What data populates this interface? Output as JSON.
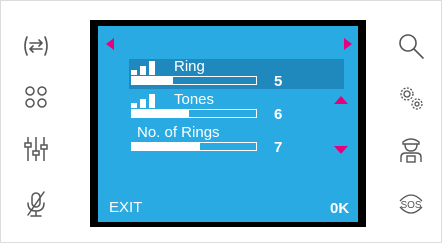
{
  "left_buttons": [
    {
      "icon": "transfer-arrows-icon"
    },
    {
      "icon": "four-circles-icon"
    },
    {
      "icon": "sliders-icon"
    },
    {
      "icon": "mic-muted-icon"
    }
  ],
  "right_buttons": [
    {
      "icon": "search-icon"
    },
    {
      "icon": "settings-gears-icon"
    },
    {
      "icon": "concierge-icon"
    },
    {
      "icon": "sos-icon"
    }
  ],
  "menu": {
    "items": [
      {
        "label": "Ring",
        "value": "5",
        "level": 0.33,
        "selected": true,
        "has_bars": true
      },
      {
        "label": "Tones",
        "value": "6",
        "level": 0.46,
        "selected": false,
        "has_bars": true
      },
      {
        "label": "No. of Rings",
        "value": "7",
        "level": 0.55,
        "selected": false,
        "has_bars": false
      }
    ]
  },
  "softkeys": {
    "left": "EXIT",
    "right": "0K"
  },
  "colors": {
    "lcd_background": "#29aae2",
    "selection": "#1f88bd",
    "arrow": "#e6007e",
    "icon_stroke": "#555555"
  }
}
